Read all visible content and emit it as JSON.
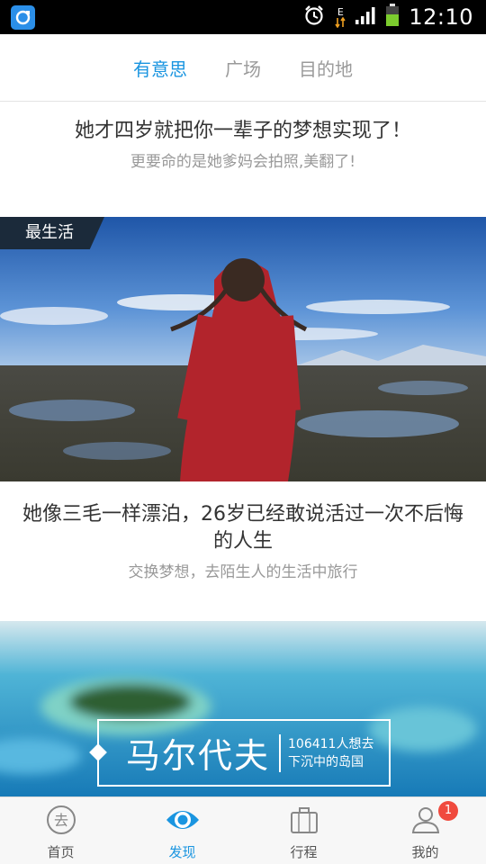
{
  "status_bar": {
    "time": "12:10",
    "network": "E"
  },
  "top_tabs": [
    {
      "label": "有意思",
      "active": true
    },
    {
      "label": "广场",
      "active": false
    },
    {
      "label": "目的地",
      "active": false
    }
  ],
  "feed": {
    "article1": {
      "title": "她才四岁就把你一辈子的梦想实现了！",
      "subtitle": "更要命的是她爹妈会拍照,美翻了!"
    },
    "article2": {
      "tag": "最生活",
      "title": "她像三毛一样漂泊，26岁已经敢说活过一次不后悔的人生",
      "subtitle": "交换梦想，去陌生人的生活中旅行"
    },
    "destination": {
      "name": "马尔代夫",
      "wish_count": "106411人想去",
      "tagline": "下沉中的岛国"
    }
  },
  "bottom_nav": [
    {
      "label": "首页",
      "icon": "go-icon",
      "active": false
    },
    {
      "label": "发现",
      "icon": "eye-icon",
      "active": true
    },
    {
      "label": "行程",
      "icon": "luggage-icon",
      "active": false
    },
    {
      "label": "我的",
      "icon": "user-icon",
      "active": false,
      "badge": "1"
    }
  ],
  "colors": {
    "accent": "#1a95e0",
    "badge": "#f04a3e",
    "ribbon": "#1b2a3a"
  }
}
